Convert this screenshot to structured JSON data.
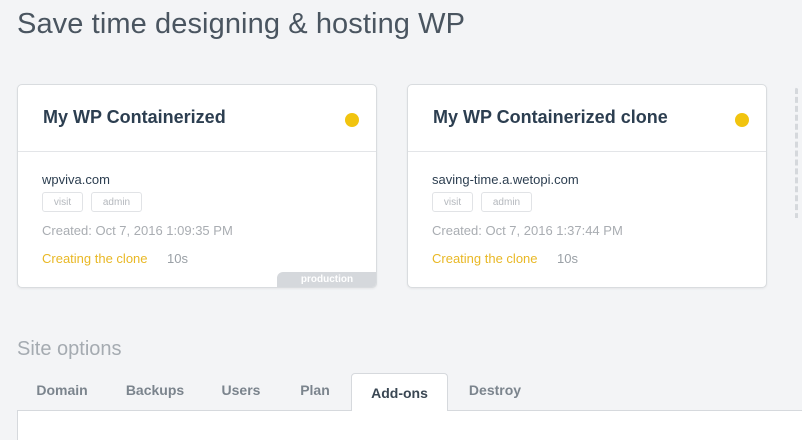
{
  "page": {
    "title": "Save time designing & hosting WP"
  },
  "colors": {
    "status_creating": "#f1c40f",
    "status_text": "#e9b825",
    "badge_bg": "#d5d8dc"
  },
  "sites": [
    {
      "name": "My WP Containerized",
      "domain": "wpviva.com",
      "visit_label": "visit",
      "admin_label": "admin",
      "created": "Created: Oct 7, 2016 1:09:35 PM",
      "status": "Creating the clone",
      "elapsed": "10s",
      "environment": "production"
    },
    {
      "name": "My WP Containerized clone",
      "domain": "saving-time.a.wetopi.com",
      "visit_label": "visit",
      "admin_label": "admin",
      "created": "Created: Oct 7, 2016 1:37:44 PM",
      "status": "Creating the clone",
      "elapsed": "10s"
    }
  ],
  "site_options": {
    "title": "Site options",
    "tabs": [
      "Domain",
      "Backups",
      "Users",
      "Plan",
      "Add-ons",
      "Destroy"
    ],
    "active_tab": "Add-ons"
  }
}
